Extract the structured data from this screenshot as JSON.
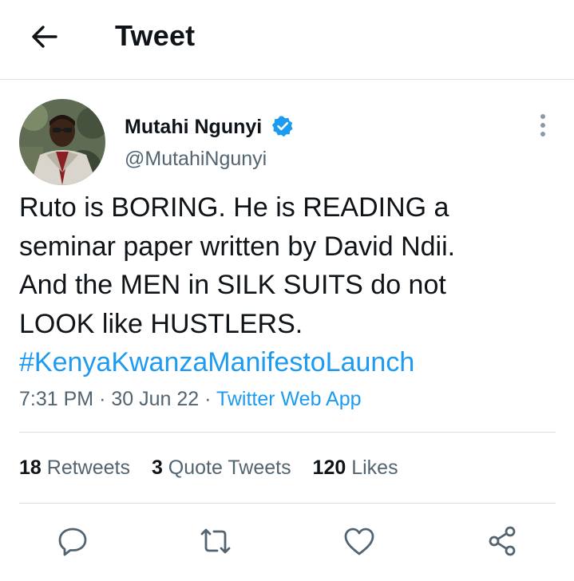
{
  "header": {
    "title": "Tweet",
    "back_icon": "arrow-left-icon"
  },
  "author": {
    "name": "Mutahi Ngunyi",
    "handle": "@MutahiNgunyi",
    "verified_icon": "verified-badge-icon",
    "avatar": "profile-photo"
  },
  "tweet": {
    "lines": [
      "Ruto is BORING. He is READING a",
      "seminar paper written by David Ndii.",
      "And the MEN in SILK SUITS do not",
      "LOOK like HUSTLERS."
    ],
    "hashtag": "#KenyaKwanzaManifestoLaunch"
  },
  "meta": {
    "time": "7:31 PM",
    "separator": "·",
    "date": "30 Jun 22",
    "source": "Twitter Web App"
  },
  "stats": [
    {
      "count": "18",
      "label": "Retweets"
    },
    {
      "count": "3",
      "label": "Quote Tweets"
    },
    {
      "count": "120",
      "label": "Likes"
    }
  ],
  "actions": [
    "reply-icon",
    "retweet-icon",
    "like-icon",
    "share-icon"
  ],
  "colors": {
    "accent": "#1d9bf0",
    "secondary_text": "#536471",
    "primary_text": "#0f1419",
    "border": "#dcdfe2"
  }
}
